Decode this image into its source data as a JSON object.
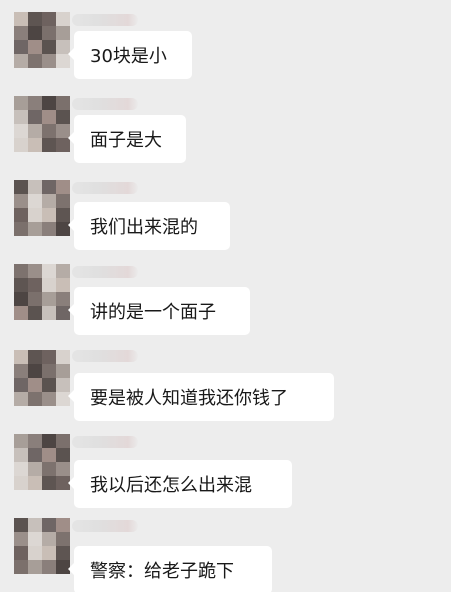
{
  "chat": {
    "messages": [
      {
        "text": "30块是小"
      },
      {
        "text": "面子是大"
      },
      {
        "text": "我们出来混的"
      },
      {
        "text": "讲的是一个面子"
      },
      {
        "text": "要是被人知道我还你钱了"
      },
      {
        "text": "我以后还怎么出来混"
      },
      {
        "text": "警察：给老子跪下"
      }
    ]
  },
  "colors": {
    "background": "#ededed",
    "bubble": "#ffffff",
    "text": "#191919"
  }
}
